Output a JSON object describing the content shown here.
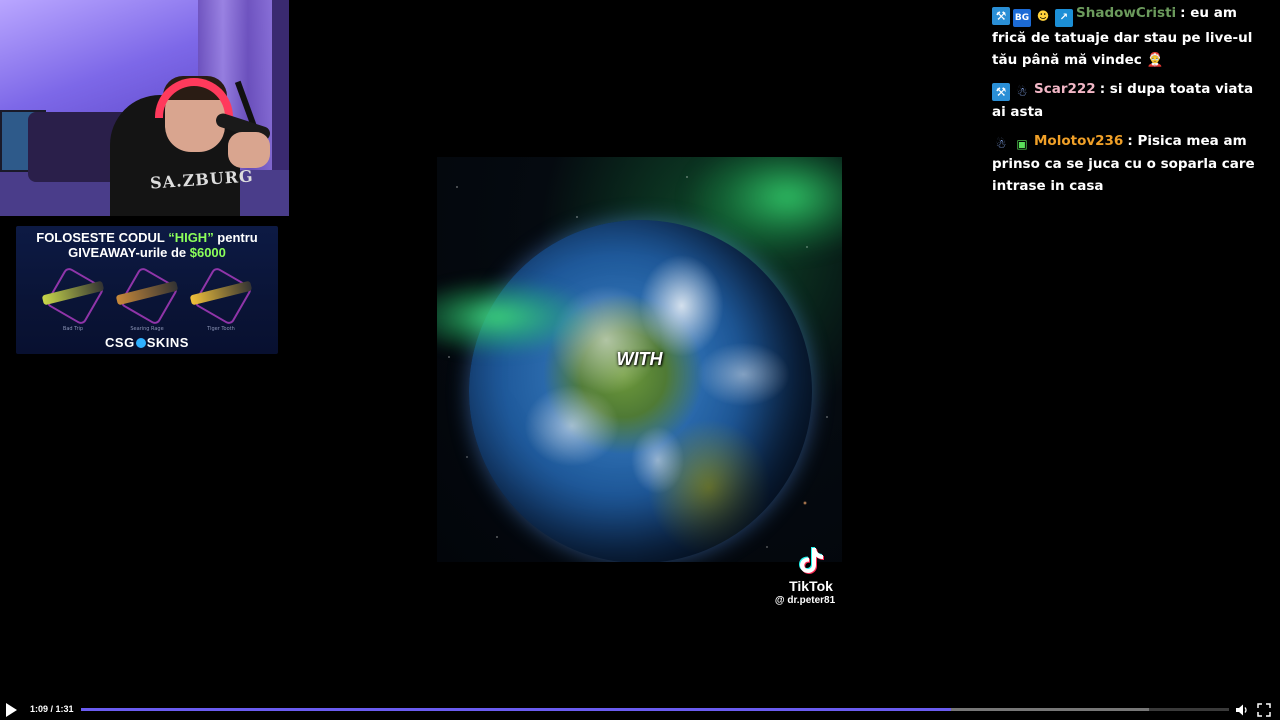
{
  "ad": {
    "line1_prefix": "FOLOSESTE CODUL ",
    "line1_code": "“HIGH”",
    "line1_suffix": " pentru",
    "line2_prefix": "GIVEAWAY-urile de ",
    "line2_amount": "$6000",
    "items": [
      {
        "name": "Bad Trip",
        "color": "#c9d84a"
      },
      {
        "name": "Searing Rage",
        "color": "#c98a3a"
      },
      {
        "name": "Tiger Tooth",
        "color": "#f2c23a"
      }
    ],
    "brand_left": "CSG",
    "brand_right": "SKINS"
  },
  "video": {
    "caption_word": "WITH",
    "tiktok_label": "TikTok",
    "tiktok_user": "@ dr.peter81"
  },
  "chat": {
    "messages": [
      {
        "badges": [
          "hammer-icon",
          "bg-badge-icon",
          "mascot-icon",
          "tier-icon"
        ],
        "name": "ShadowCristi",
        "name_color": "#6b9a5c",
        "text": "eu am frică de tatuaje dar stau pe live-ul tău până mă vindec 🤶"
      },
      {
        "badges": [
          "hammer-icon",
          "robot-icon"
        ],
        "name": "Scar222",
        "name_color": "#f2b7c6",
        "text": "si dupa toata viata ai asta"
      },
      {
        "badges": [
          "robot-icon",
          "gift-icon"
        ],
        "name": "Molotov236",
        "name_color": "#f0a028",
        "text": "Pisica mea am prinso ca se juca cu o soparla care intrase in casa"
      }
    ]
  },
  "player": {
    "time": "1:09 / 1:31",
    "progress": 0.758,
    "buffered": 0.93,
    "accent": "#6a5cf0"
  }
}
